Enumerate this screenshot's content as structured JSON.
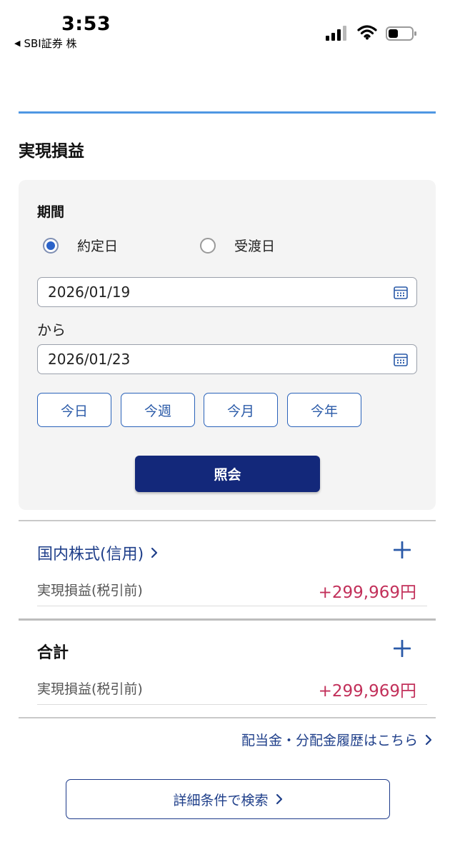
{
  "status_bar": {
    "time": "3:53",
    "back_app": "SBI証券 株",
    "icons": [
      "cellular-signal-icon",
      "wifi-icon",
      "battery-icon"
    ]
  },
  "page": {
    "section_title": "実現損益"
  },
  "filter": {
    "period_label": "期間",
    "radio_options": [
      {
        "label": "約定日",
        "checked": true
      },
      {
        "label": "受渡日",
        "checked": false
      }
    ],
    "date_from": "2026/01/19",
    "between_label": "から",
    "date_to": "2026/01/23",
    "quick_buttons": [
      "今日",
      "今週",
      "今月",
      "今年"
    ],
    "submit_label": "照会"
  },
  "results": [
    {
      "title": "国内株式(信用)",
      "sub_label": "実現損益(税引前)",
      "amount": "+299,969円"
    },
    {
      "title": "合計",
      "sub_label": "実現損益(税引前)",
      "amount": "+299,969円"
    }
  ],
  "links": {
    "dividend_history": "配当金・分配金履歴はこちら",
    "detailed_search": "詳細条件で検索"
  },
  "colors": {
    "accent_rule": "#4f97e3",
    "primary_navy": "#13287a",
    "link_blue": "#1f3f8a",
    "amount_red": "#c2305a",
    "panel_bg": "#f4f4f4"
  }
}
